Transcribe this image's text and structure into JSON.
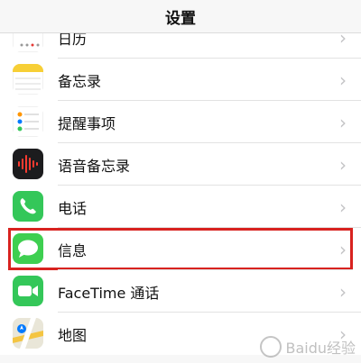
{
  "navbar": {
    "title": "设置"
  },
  "rows": [
    {
      "label": "日历",
      "icon": "calendar-icon"
    },
    {
      "label": "备忘录",
      "icon": "notes-icon"
    },
    {
      "label": "提醒事项",
      "icon": "reminders-icon"
    },
    {
      "label": "语音备忘录",
      "icon": "voice-memos-icon"
    },
    {
      "label": "电话",
      "icon": "phone-icon"
    },
    {
      "label": "信息",
      "icon": "messages-icon",
      "highlighted": true
    },
    {
      "label": "FaceTime 通话",
      "icon": "facetime-icon"
    },
    {
      "label": "地图",
      "icon": "maps-icon"
    }
  ],
  "chevron": "›",
  "colors": {
    "highlight": "#d8221f",
    "messages_green": "#3ecf50",
    "facetime_green": "#34c759",
    "notes_yellow": "#f7cf36"
  },
  "watermark": {
    "text": "Baidu经验"
  }
}
